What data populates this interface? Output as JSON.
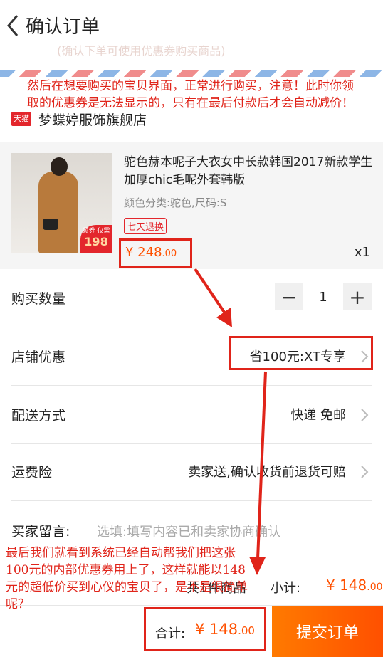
{
  "header": {
    "title": "确认订单",
    "back_icon": "chevron-left-icon"
  },
  "faded_line": "(确认下单可使用优惠券购买商品)",
  "annotations": {
    "note1": "然后在想要购买的宝贝界面，正常进行购买，注意！此时你领取的优惠券是无法显示的，只有在最后付款后才会自动减价！",
    "note2": "最后我们就看到系统已经自动帮我们把这张100元的内部优惠券用上了，这样就能以148元的超低价买到心仪的宝贝了，是不是很简单呢？",
    "color": "#e0241a"
  },
  "shop": {
    "badge": "天猫",
    "name": "梦蝶婷服饰旗舰店"
  },
  "product": {
    "title": "驼色赫本呢子大衣女中长款韩国2017新款学生加厚chic毛呢外套韩版",
    "spec": "颜色分类:驼色,尺码:S",
    "tag": "七天退换",
    "price_main": "¥ 248",
    "price_decimal": ".00",
    "qty": "x1",
    "image_badge_top": "领券 仅需",
    "image_badge_price": "198"
  },
  "rows": {
    "quantity": {
      "label": "购买数量",
      "minus": "−",
      "value": "1",
      "plus": "+"
    },
    "coupon": {
      "label": "店铺优惠",
      "value": "省100元:XT专享"
    },
    "delivery": {
      "label": "配送方式",
      "value": "快递 免邮"
    },
    "insurance": {
      "label": "运费险",
      "value": "卖家送,确认收货前退货可赔"
    }
  },
  "message": {
    "label": "买家留言:",
    "placeholder": "选填:填写内容已和卖家协商确认"
  },
  "summary": {
    "count": "共1件商品",
    "subtotal_label": "小计:",
    "subtotal_main": "¥ 148",
    "subtotal_decimal": ".00"
  },
  "bottom": {
    "total_label": "合计:",
    "total_main": "¥ 148",
    "total_decimal": ".00",
    "submit": "提交订单"
  },
  "colors": {
    "accent": "#ff5000",
    "tmall": "#e3262c",
    "highlight": "#e0241a"
  }
}
